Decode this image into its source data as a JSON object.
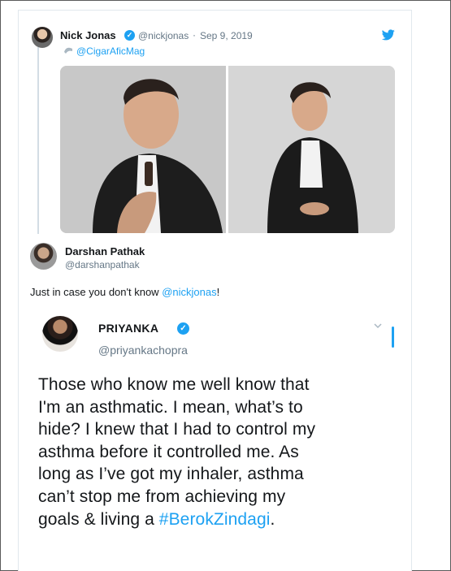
{
  "tweet": {
    "author_name": "Nick Jonas",
    "author_handle": "@nickjonas",
    "separator": "·",
    "date": "Sep 9, 2019",
    "mention": "@CigarAficMag"
  },
  "reply": {
    "author_name": "Darshan Pathak",
    "author_handle": "@darshanpathak",
    "text_prefix": "Just in case you don't know ",
    "text_mention": "@nickjonas",
    "text_suffix": "!"
  },
  "quoted": {
    "author_name": "PRIYANKA",
    "author_handle": "@priyankachopra",
    "lines": [
      "Those who know me well know that",
      "I'm an asthmatic. I mean, what’s to",
      "hide? I knew that I had to control my",
      "asthma before it controlled me. As",
      "long as I’ve got my inhaler, asthma",
      "can’t stop me from achieving my"
    ],
    "last_line_prefix": "goals & living a ",
    "hashtag": "#BerokZindagi",
    "last_line_suffix": "."
  },
  "colors": {
    "accent": "#1da1f2",
    "secondary_text": "#657786"
  },
  "icons": {
    "verified": "verified-badge-icon",
    "twitter": "twitter-bird-icon",
    "chevron": "chevron-down-icon"
  }
}
